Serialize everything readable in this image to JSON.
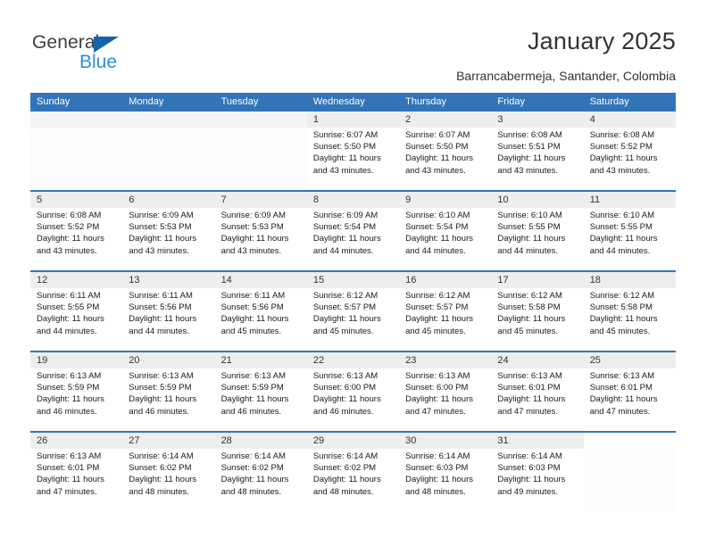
{
  "brand": {
    "name_dark": "General",
    "name_light": "Blue",
    "accent_color": "#1464aa",
    "light_color": "#2f8fd8"
  },
  "header": {
    "title": "January 2025",
    "subtitle": "Barrancabermeja, Santander, Colombia"
  },
  "calendar": {
    "header_color": "#3274b8",
    "weekdays": [
      "Sunday",
      "Monday",
      "Tuesday",
      "Wednesday",
      "Thursday",
      "Friday",
      "Saturday"
    ],
    "weeks": [
      [
        {
          "day": "",
          "lines": []
        },
        {
          "day": "",
          "lines": []
        },
        {
          "day": "",
          "lines": []
        },
        {
          "day": "1",
          "lines": [
            "Sunrise: 6:07 AM",
            "Sunset: 5:50 PM",
            "Daylight: 11 hours and 43 minutes."
          ]
        },
        {
          "day": "2",
          "lines": [
            "Sunrise: 6:07 AM",
            "Sunset: 5:50 PM",
            "Daylight: 11 hours and 43 minutes."
          ]
        },
        {
          "day": "3",
          "lines": [
            "Sunrise: 6:08 AM",
            "Sunset: 5:51 PM",
            "Daylight: 11 hours and 43 minutes."
          ]
        },
        {
          "day": "4",
          "lines": [
            "Sunrise: 6:08 AM",
            "Sunset: 5:52 PM",
            "Daylight: 11 hours and 43 minutes."
          ]
        }
      ],
      [
        {
          "day": "5",
          "lines": [
            "Sunrise: 6:08 AM",
            "Sunset: 5:52 PM",
            "Daylight: 11 hours and 43 minutes."
          ]
        },
        {
          "day": "6",
          "lines": [
            "Sunrise: 6:09 AM",
            "Sunset: 5:53 PM",
            "Daylight: 11 hours and 43 minutes."
          ]
        },
        {
          "day": "7",
          "lines": [
            "Sunrise: 6:09 AM",
            "Sunset: 5:53 PM",
            "Daylight: 11 hours and 43 minutes."
          ]
        },
        {
          "day": "8",
          "lines": [
            "Sunrise: 6:09 AM",
            "Sunset: 5:54 PM",
            "Daylight: 11 hours and 44 minutes."
          ]
        },
        {
          "day": "9",
          "lines": [
            "Sunrise: 6:10 AM",
            "Sunset: 5:54 PM",
            "Daylight: 11 hours and 44 minutes."
          ]
        },
        {
          "day": "10",
          "lines": [
            "Sunrise: 6:10 AM",
            "Sunset: 5:55 PM",
            "Daylight: 11 hours and 44 minutes."
          ]
        },
        {
          "day": "11",
          "lines": [
            "Sunrise: 6:10 AM",
            "Sunset: 5:55 PM",
            "Daylight: 11 hours and 44 minutes."
          ]
        }
      ],
      [
        {
          "day": "12",
          "lines": [
            "Sunrise: 6:11 AM",
            "Sunset: 5:55 PM",
            "Daylight: 11 hours and 44 minutes."
          ]
        },
        {
          "day": "13",
          "lines": [
            "Sunrise: 6:11 AM",
            "Sunset: 5:56 PM",
            "Daylight: 11 hours and 44 minutes."
          ]
        },
        {
          "day": "14",
          "lines": [
            "Sunrise: 6:11 AM",
            "Sunset: 5:56 PM",
            "Daylight: 11 hours and 45 minutes."
          ]
        },
        {
          "day": "15",
          "lines": [
            "Sunrise: 6:12 AM",
            "Sunset: 5:57 PM",
            "Daylight: 11 hours and 45 minutes."
          ]
        },
        {
          "day": "16",
          "lines": [
            "Sunrise: 6:12 AM",
            "Sunset: 5:57 PM",
            "Daylight: 11 hours and 45 minutes."
          ]
        },
        {
          "day": "17",
          "lines": [
            "Sunrise: 6:12 AM",
            "Sunset: 5:58 PM",
            "Daylight: 11 hours and 45 minutes."
          ]
        },
        {
          "day": "18",
          "lines": [
            "Sunrise: 6:12 AM",
            "Sunset: 5:58 PM",
            "Daylight: 11 hours and 45 minutes."
          ]
        }
      ],
      [
        {
          "day": "19",
          "lines": [
            "Sunrise: 6:13 AM",
            "Sunset: 5:59 PM",
            "Daylight: 11 hours and 46 minutes."
          ]
        },
        {
          "day": "20",
          "lines": [
            "Sunrise: 6:13 AM",
            "Sunset: 5:59 PM",
            "Daylight: 11 hours and 46 minutes."
          ]
        },
        {
          "day": "21",
          "lines": [
            "Sunrise: 6:13 AM",
            "Sunset: 5:59 PM",
            "Daylight: 11 hours and 46 minutes."
          ]
        },
        {
          "day": "22",
          "lines": [
            "Sunrise: 6:13 AM",
            "Sunset: 6:00 PM",
            "Daylight: 11 hours and 46 minutes."
          ]
        },
        {
          "day": "23",
          "lines": [
            "Sunrise: 6:13 AM",
            "Sunset: 6:00 PM",
            "Daylight: 11 hours and 47 minutes."
          ]
        },
        {
          "day": "24",
          "lines": [
            "Sunrise: 6:13 AM",
            "Sunset: 6:01 PM",
            "Daylight: 11 hours and 47 minutes."
          ]
        },
        {
          "day": "25",
          "lines": [
            "Sunrise: 6:13 AM",
            "Sunset: 6:01 PM",
            "Daylight: 11 hours and 47 minutes."
          ]
        }
      ],
      [
        {
          "day": "26",
          "lines": [
            "Sunrise: 6:13 AM",
            "Sunset: 6:01 PM",
            "Daylight: 11 hours and 47 minutes."
          ]
        },
        {
          "day": "27",
          "lines": [
            "Sunrise: 6:14 AM",
            "Sunset: 6:02 PM",
            "Daylight: 11 hours and 48 minutes."
          ]
        },
        {
          "day": "28",
          "lines": [
            "Sunrise: 6:14 AM",
            "Sunset: 6:02 PM",
            "Daylight: 11 hours and 48 minutes."
          ]
        },
        {
          "day": "29",
          "lines": [
            "Sunrise: 6:14 AM",
            "Sunset: 6:02 PM",
            "Daylight: 11 hours and 48 minutes."
          ]
        },
        {
          "day": "30",
          "lines": [
            "Sunrise: 6:14 AM",
            "Sunset: 6:03 PM",
            "Daylight: 11 hours and 48 minutes."
          ]
        },
        {
          "day": "31",
          "lines": [
            "Sunrise: 6:14 AM",
            "Sunset: 6:03 PM",
            "Daylight: 11 hours and 49 minutes."
          ]
        },
        {
          "day": "",
          "lines": []
        }
      ]
    ]
  }
}
